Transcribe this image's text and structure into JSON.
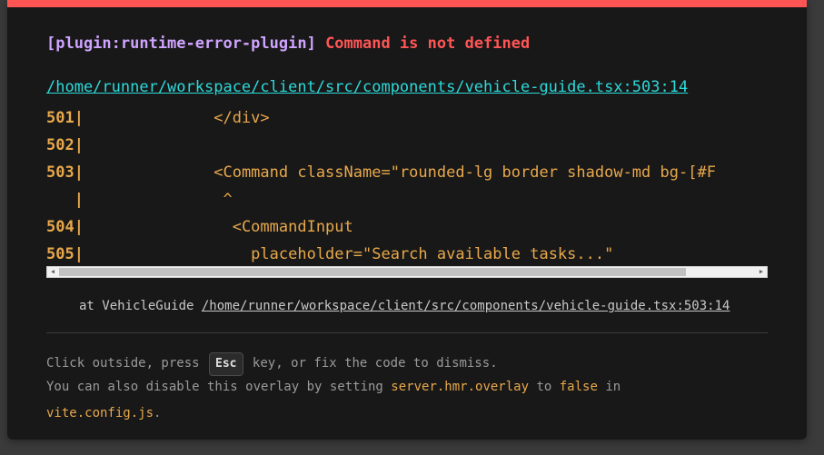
{
  "error": {
    "plugin": "[plugin:runtime-error-plugin]",
    "message": "Command is not defined"
  },
  "file": "/home/runner/workspace/client/src/components/vehicle-guide.tsx:503:14",
  "frame": {
    "lines": [
      {
        "num": "501|",
        "code": "              </div>"
      },
      {
        "num": "502|",
        "code": ""
      },
      {
        "num": "503|",
        "code": "              <Command className=\"rounded-lg border shadow-md bg-[#F"
      },
      {
        "num": "   |",
        "code": "               ^"
      },
      {
        "num": "504|",
        "code": "                <CommandInput"
      },
      {
        "num": "505|",
        "code": "                  placeholder=\"Search available tasks...\""
      }
    ]
  },
  "stack": {
    "prefix": "at VehicleGuide ",
    "file": "/home/runner/workspace/client/src/components/vehicle-guide.tsx:503:14"
  },
  "tip": {
    "part1": "Click outside, press ",
    "key": "Esc",
    "part2": " key, or fix the code to dismiss.",
    "line2_part1": "You can also disable this overlay by setting ",
    "setting": "server.hmr.overlay",
    "line2_part2": " to ",
    "false_word": "false",
    "line2_part3": " in",
    "config_file": "vite.config.js",
    "period": "."
  }
}
